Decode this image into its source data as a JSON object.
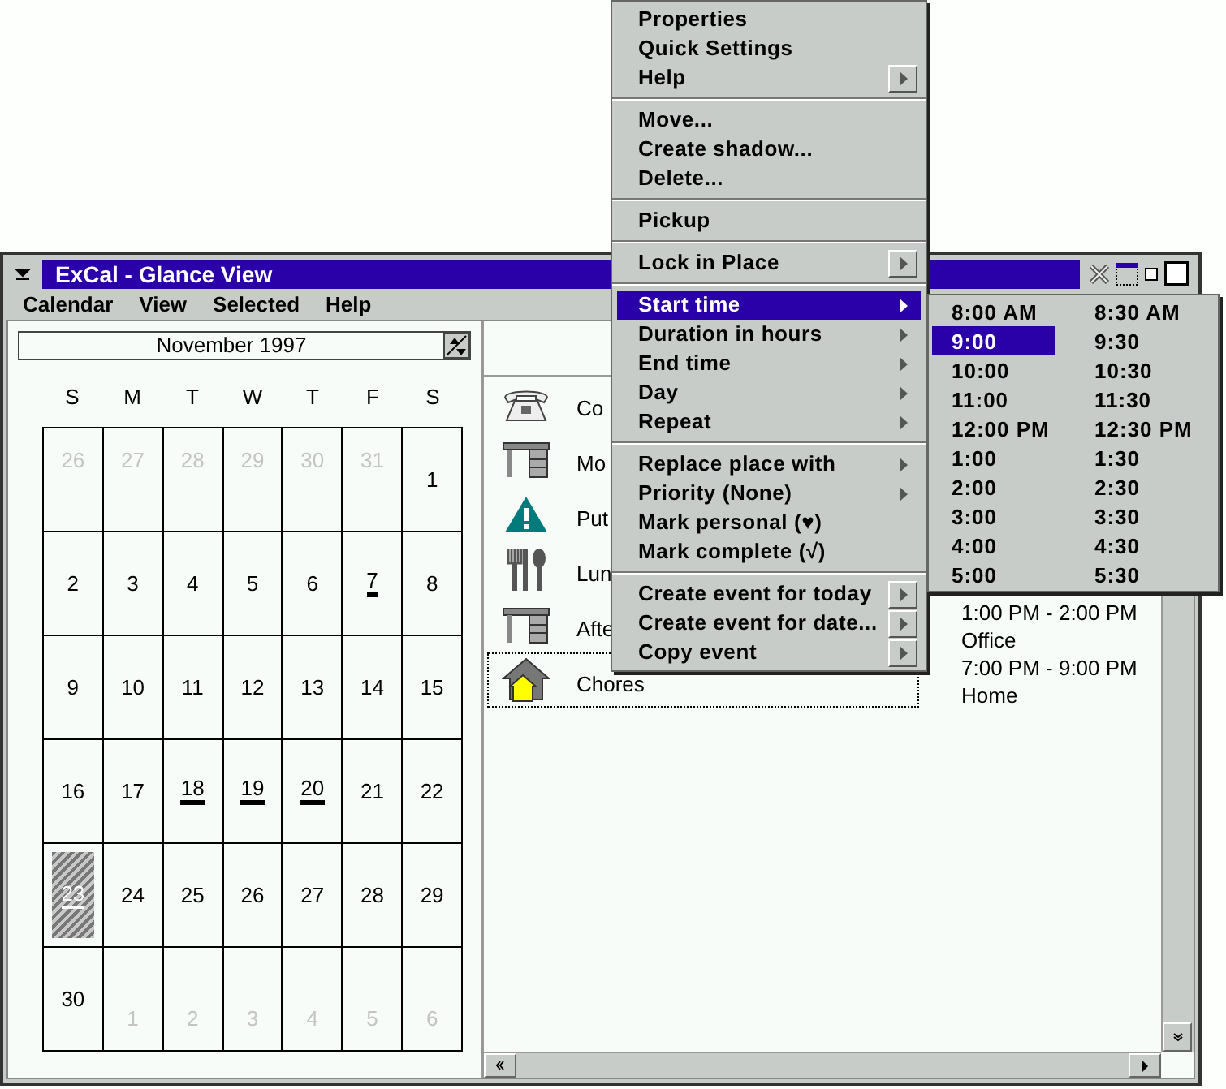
{
  "window": {
    "title": "ExCal - Glance View"
  },
  "menubar": [
    "Calendar",
    "View",
    "Selected",
    "Help"
  ],
  "month_field": {
    "value": "November 1997"
  },
  "weekdays": [
    "S",
    "M",
    "T",
    "W",
    "T",
    "F",
    "S"
  ],
  "days": [
    {
      "label": "26",
      "other_month": true,
      "marked": false,
      "selected": false
    },
    {
      "label": "27",
      "other_month": true,
      "marked": false,
      "selected": false
    },
    {
      "label": "28",
      "other_month": true,
      "marked": false,
      "selected": false
    },
    {
      "label": "29",
      "other_month": true,
      "marked": false,
      "selected": false
    },
    {
      "label": "30",
      "other_month": true,
      "marked": false,
      "selected": false
    },
    {
      "label": "31",
      "other_month": true,
      "marked": false,
      "selected": false
    },
    {
      "label": "1",
      "other_month": false,
      "marked": false,
      "selected": false
    },
    {
      "label": "2",
      "other_month": false,
      "marked": false,
      "selected": false
    },
    {
      "label": "3",
      "other_month": false,
      "marked": false,
      "selected": false
    },
    {
      "label": "4",
      "other_month": false,
      "marked": false,
      "selected": false
    },
    {
      "label": "5",
      "other_month": false,
      "marked": false,
      "selected": false
    },
    {
      "label": "6",
      "other_month": false,
      "marked": false,
      "selected": false
    },
    {
      "label": "7",
      "other_month": false,
      "marked": true,
      "selected": false
    },
    {
      "label": "8",
      "other_month": false,
      "marked": false,
      "selected": false
    },
    {
      "label": "9",
      "other_month": false,
      "marked": false,
      "selected": false
    },
    {
      "label": "10",
      "other_month": false,
      "marked": false,
      "selected": false
    },
    {
      "label": "11",
      "other_month": false,
      "marked": false,
      "selected": false
    },
    {
      "label": "12",
      "other_month": false,
      "marked": false,
      "selected": false
    },
    {
      "label": "13",
      "other_month": false,
      "marked": false,
      "selected": false
    },
    {
      "label": "14",
      "other_month": false,
      "marked": false,
      "selected": false
    },
    {
      "label": "15",
      "other_month": false,
      "marked": false,
      "selected": false
    },
    {
      "label": "16",
      "other_month": false,
      "marked": false,
      "selected": false
    },
    {
      "label": "17",
      "other_month": false,
      "marked": false,
      "selected": false
    },
    {
      "label": "18",
      "other_month": false,
      "marked": true,
      "selected": false
    },
    {
      "label": "19",
      "other_month": false,
      "marked": true,
      "selected": false
    },
    {
      "label": "20",
      "other_month": false,
      "marked": true,
      "selected": false
    },
    {
      "label": "21",
      "other_month": false,
      "marked": false,
      "selected": false
    },
    {
      "label": "22",
      "other_month": false,
      "marked": false,
      "selected": false
    },
    {
      "label": "23",
      "other_month": false,
      "marked": true,
      "selected": true
    },
    {
      "label": "24",
      "other_month": false,
      "marked": false,
      "selected": false
    },
    {
      "label": "25",
      "other_month": false,
      "marked": false,
      "selected": false
    },
    {
      "label": "26",
      "other_month": false,
      "marked": false,
      "selected": false
    },
    {
      "label": "27",
      "other_month": false,
      "marked": false,
      "selected": false
    },
    {
      "label": "28",
      "other_month": false,
      "marked": false,
      "selected": false
    },
    {
      "label": "29",
      "other_month": false,
      "marked": false,
      "selected": false
    },
    {
      "label": "30",
      "other_month": false,
      "marked": false,
      "selected": false
    },
    {
      "label": "1",
      "other_month": true,
      "marked": false,
      "selected": false
    },
    {
      "label": "2",
      "other_month": true,
      "marked": false,
      "selected": false
    },
    {
      "label": "3",
      "other_month": true,
      "marked": false,
      "selected": false
    },
    {
      "label": "4",
      "other_month": true,
      "marked": false,
      "selected": false
    },
    {
      "label": "5",
      "other_month": true,
      "marked": false,
      "selected": false
    },
    {
      "label": "6",
      "other_month": true,
      "marked": false,
      "selected": false
    }
  ],
  "events": [
    {
      "label": "Co",
      "kind": "phone",
      "selected": false
    },
    {
      "label": "Mo",
      "kind": "desk",
      "selected": false
    },
    {
      "label": "Put",
      "kind": "warning",
      "selected": false
    },
    {
      "label": "Lun",
      "kind": "meal",
      "selected": false
    },
    {
      "label": "Afte",
      "kind": "desk",
      "selected": false
    },
    {
      "label": "Chores",
      "kind": "house",
      "selected": true
    }
  ],
  "details": [
    "1:00 PM - 2:00 PM",
    "Office",
    "7:00 PM - 9:00 PM",
    "Home"
  ],
  "context_menu": [
    [
      {
        "label": "Properties",
        "kind": "plain",
        "selected": false
      },
      {
        "label": "Quick Settings",
        "kind": "plain",
        "selected": false
      },
      {
        "label": "Help",
        "kind": "button",
        "selected": false
      }
    ],
    [
      {
        "label": "Move...",
        "kind": "plain",
        "selected": false
      },
      {
        "label": "Create shadow...",
        "kind": "plain",
        "selected": false
      },
      {
        "label": "Delete...",
        "kind": "plain",
        "selected": false
      }
    ],
    [
      {
        "label": "Pickup",
        "kind": "plain",
        "selected": false
      }
    ],
    [
      {
        "label": "Lock in Place",
        "kind": "button",
        "selected": false
      }
    ],
    [
      {
        "label": "Start time",
        "kind": "arrow",
        "selected": true
      },
      {
        "label": "Duration in hours",
        "kind": "arrow",
        "selected": false
      },
      {
        "label": "End time",
        "kind": "arrow",
        "selected": false
      },
      {
        "label": "Day",
        "kind": "arrow",
        "selected": false
      },
      {
        "label": "Repeat",
        "kind": "arrow",
        "selected": false
      }
    ],
    [
      {
        "label": "Replace place with",
        "kind": "arrow",
        "selected": false
      },
      {
        "label": "Priority (None)",
        "kind": "arrow",
        "selected": false
      },
      {
        "label": "Mark personal (♥)",
        "kind": "plain",
        "selected": false
      },
      {
        "label": "Mark complete (√)",
        "kind": "plain",
        "selected": false
      }
    ],
    [
      {
        "label": "Create event for today",
        "kind": "button",
        "selected": false
      },
      {
        "label": "Create event for date...",
        "kind": "button",
        "selected": false
      },
      {
        "label": "Copy event",
        "kind": "button",
        "selected": false
      }
    ]
  ],
  "submenu": [
    {
      "label": "8:00 AM",
      "selected": false
    },
    {
      "label": "8:30 AM",
      "selected": false
    },
    {
      "label": "9:00",
      "selected": true
    },
    {
      "label": "9:30",
      "selected": false
    },
    {
      "label": "10:00",
      "selected": false
    },
    {
      "label": "10:30",
      "selected": false
    },
    {
      "label": "11:00",
      "selected": false
    },
    {
      "label": "11:30",
      "selected": false
    },
    {
      "label": "12:00 PM",
      "selected": false
    },
    {
      "label": "12:30 PM",
      "selected": false
    },
    {
      "label": "1:00",
      "selected": false
    },
    {
      "label": "1:30",
      "selected": false
    },
    {
      "label": "2:00",
      "selected": false
    },
    {
      "label": "2:30",
      "selected": false
    },
    {
      "label": "3:00",
      "selected": false
    },
    {
      "label": "3:30",
      "selected": false
    },
    {
      "label": "4:00",
      "selected": false
    },
    {
      "label": "4:30",
      "selected": false
    },
    {
      "label": "5:00",
      "selected": false
    },
    {
      "label": "5:30",
      "selected": false
    }
  ]
}
